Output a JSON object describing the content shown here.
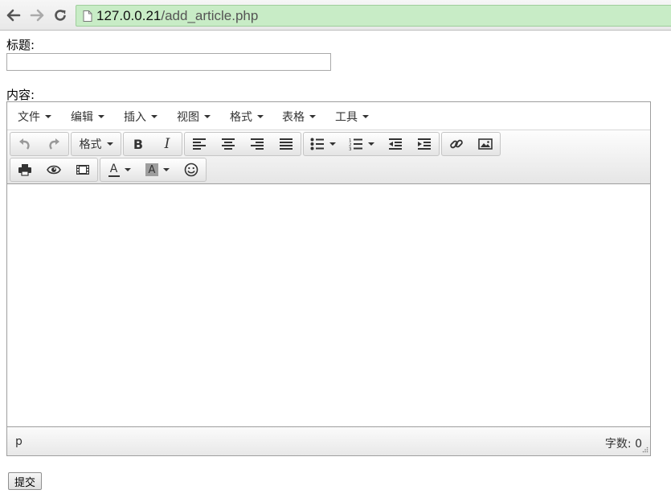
{
  "browser": {
    "url_host": "127.0.0.21",
    "url_path": "/add_article.php"
  },
  "form": {
    "title_label": "标题:",
    "title_value": "",
    "content_label": "内容:",
    "submit_label": "提交"
  },
  "editor": {
    "menu": [
      "文件",
      "编辑",
      "插入",
      "视图",
      "格式",
      "表格",
      "工具"
    ],
    "format_dropdown_label": "格式",
    "text_color_glyph": "A",
    "bg_color_glyph": "A",
    "bold_glyph": "B",
    "italic_glyph": "I",
    "status_path": "p",
    "word_count": "字数: 0",
    "content": ""
  },
  "colors": {
    "omnibox_bg": "#c8ecc6",
    "border": "#9e9e9e"
  }
}
